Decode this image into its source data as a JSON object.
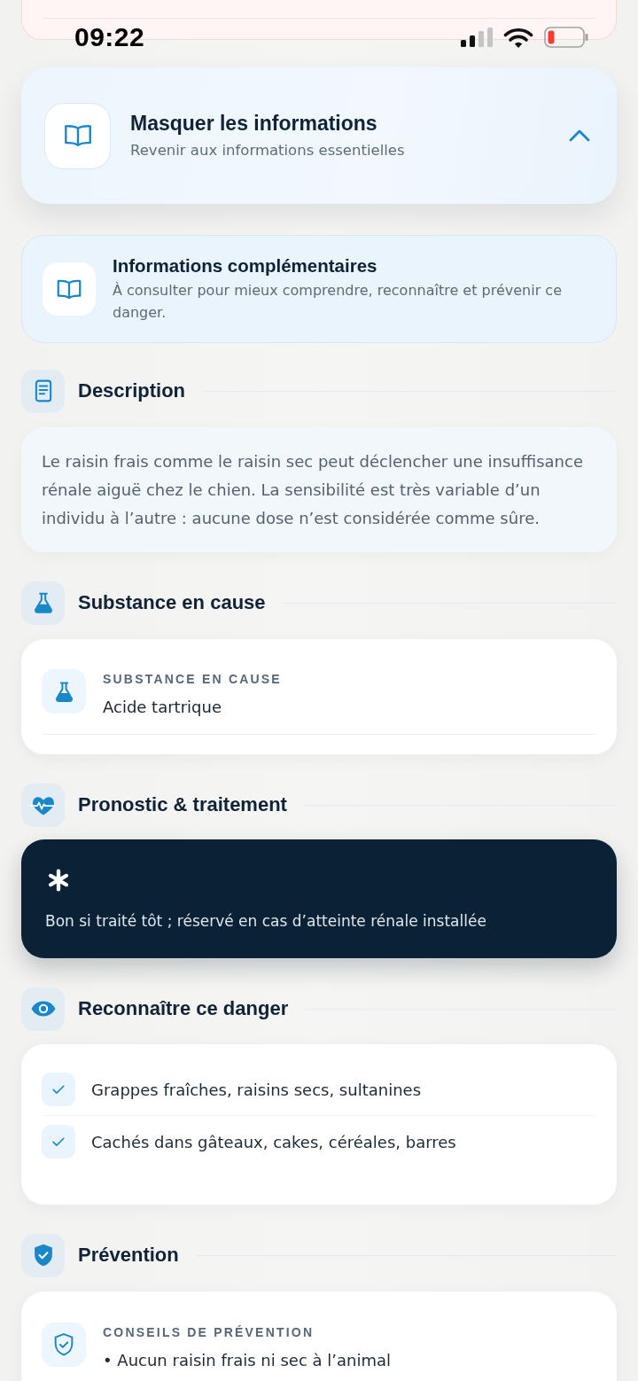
{
  "status_bar": {
    "time": "09:22"
  },
  "toggle": {
    "title": "Masquer les informations",
    "subtitle": "Revenir aux informations essentielles",
    "expanded": true
  },
  "intro": {
    "title": "Informations complémentaires",
    "text": "À consulter pour mieux comprendre, reconnaître et prévenir ce danger."
  },
  "sections": [
    {
      "kind": "text",
      "title": "Description",
      "text": "Le raisin frais comme le raisin sec peut déclencher une insuffisance rénale aiguë chez le chien. La sensibilité est très variable d’un individu à l’autre : aucune dose n’est considérée comme sûre."
    },
    {
      "kind": "fact",
      "title": "Substance en cause",
      "label": "SUBSTANCE EN CAUSE",
      "value": "Acide tartrique"
    },
    {
      "kind": "highlight",
      "title": "Pronostic & traitement",
      "text": "Bon si traité tôt ; réservé en cas d’atteinte rénale installée"
    },
    {
      "kind": "checklist",
      "title": "Reconnaître ce danger",
      "items": [
        "Grappes fraîches, raisins secs, sultanines",
        "Cachés dans gâteaux, cakes, céréales, barres"
      ]
    },
    {
      "kind": "tips",
      "title": "Prévention",
      "label": "CONSEILS DE PRÉVENTION",
      "items": [
        "• Aucun raisin frais ni sec à l’animal"
      ]
    }
  ]
}
